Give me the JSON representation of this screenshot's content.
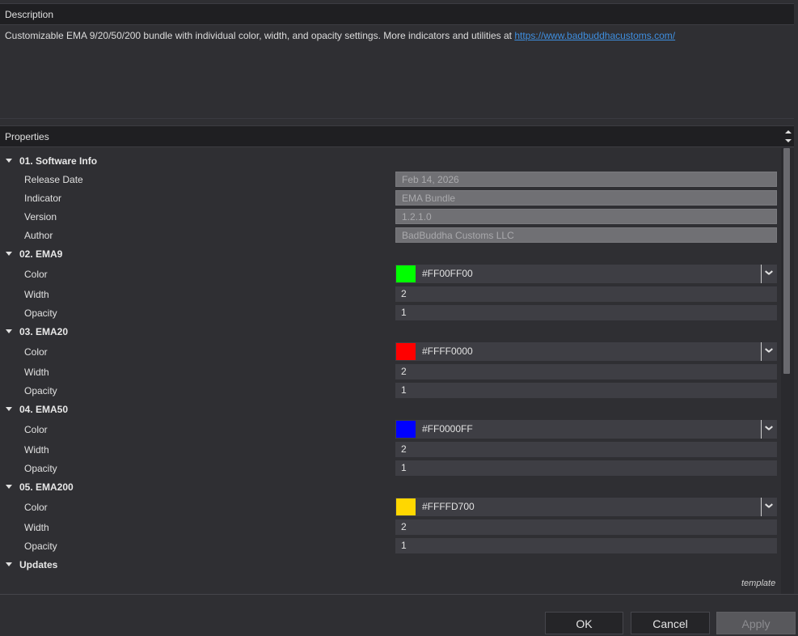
{
  "description": {
    "header": "Description",
    "text": "Customizable EMA 9/20/50/200 bundle with individual color, width, and opacity settings. More indicators and utilities at ",
    "link": "https://www.badbuddhacustoms.com/"
  },
  "properties": {
    "header": "Properties",
    "groups": [
      {
        "title": "01. Software Info",
        "rows": [
          {
            "label": "Release Date",
            "value": "Feb 14, 2026"
          },
          {
            "label": "Indicator",
            "value": "EMA Bundle"
          },
          {
            "label": "Version",
            "value": "1.2.1.0"
          },
          {
            "label": "Author",
            "value": "BadBuddha Customs LLC"
          }
        ]
      },
      {
        "title": "02. EMA9",
        "color": {
          "label": "Color",
          "value": "#FF00FF00",
          "swatch": "#00ff00"
        },
        "width": {
          "label": "Width",
          "value": "2"
        },
        "opacity": {
          "label": "Opacity",
          "value": "1"
        }
      },
      {
        "title": "03. EMA20",
        "color": {
          "label": "Color",
          "value": "#FFFF0000",
          "swatch": "#ff0000"
        },
        "width": {
          "label": "Width",
          "value": "2"
        },
        "opacity": {
          "label": "Opacity",
          "value": "1"
        }
      },
      {
        "title": "04. EMA50",
        "color": {
          "label": "Color",
          "value": "#FF0000FF",
          "swatch": "#0000ff"
        },
        "width": {
          "label": "Width",
          "value": "2"
        },
        "opacity": {
          "label": "Opacity",
          "value": "1"
        }
      },
      {
        "title": "05. EMA200",
        "color": {
          "label": "Color",
          "value": "#FFFFD700",
          "swatch": "#ffd700"
        },
        "width": {
          "label": "Width",
          "value": "2"
        },
        "opacity": {
          "label": "Opacity",
          "value": "1"
        }
      },
      {
        "title": "Updates"
      }
    ],
    "template_label": "template"
  },
  "buttons": {
    "ok": "OK",
    "cancel": "Cancel",
    "apply": "Apply"
  },
  "colors": {
    "link": "#3f8fe0",
    "panel_bg": "#2f2f33",
    "header_bg": "#1f1f22"
  }
}
